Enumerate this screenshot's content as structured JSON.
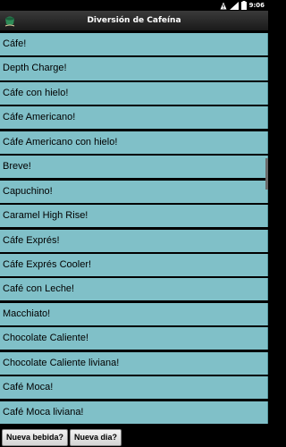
{
  "status_bar": {
    "time": "9:06",
    "icons": [
      "alert-icon",
      "signal-icon",
      "battery-icon"
    ]
  },
  "app": {
    "title": "Diversión de Cafeína",
    "logo_icon": "coffee-logo-icon"
  },
  "drinks": [
    "Cáfe!",
    "Depth Charge!",
    "Cáfe con hielo!",
    "Cáfe Americano!",
    "Cáfe Americano con hielo!",
    "Breve!",
    "Capuchino!",
    "Caramel High Rise!",
    "Cáfe Exprés!",
    "Cáfe Exprés Cooler!",
    "Café con Leche!",
    "Macchiato!",
    "Chocolate Caliente!",
    "Chocolate Caliente liviana!",
    "Café Moca!",
    "Café Moca liviana!"
  ],
  "colors": {
    "list_item": "#80c0c8",
    "background": "#000000"
  },
  "buttons": {
    "new_drink": "Nueva bebida?",
    "new_day": "Nueva dia?"
  }
}
